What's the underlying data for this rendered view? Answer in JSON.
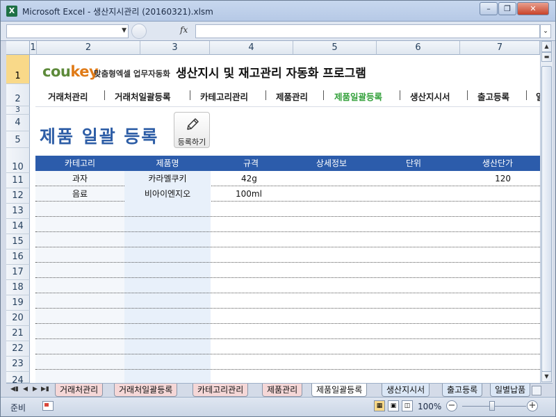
{
  "window": {
    "title": "Microsoft Excel - 생산지시관리 (20160321).xlsm",
    "app_icon": "excel-icon",
    "controls": [
      "minimize",
      "restore",
      "close"
    ]
  },
  "formula_bar": {
    "name_box": "",
    "fx_label": "fx",
    "formula": ""
  },
  "columns": [
    "1",
    "2",
    "3",
    "4",
    "5",
    "6",
    "7"
  ],
  "rows": [
    "1",
    "2",
    "3",
    "4",
    "5",
    "10",
    "11",
    "12",
    "13",
    "14",
    "15",
    "16",
    "17",
    "18",
    "19",
    "20",
    "21",
    "22",
    "23",
    "24"
  ],
  "banner": {
    "brand_a": "cou",
    "brand_b": "key",
    "brand_sub": "맞춤형엑셀 업무자동화",
    "title": "생산지시 및 재고관리 자동화 프로그램"
  },
  "nav": {
    "items": [
      "거래처관리",
      "거래처일괄등록",
      "카테고리관리",
      "제품관리",
      "제품일괄등록",
      "생산지시서",
      "출고등록",
      "일"
    ],
    "active_index": 4
  },
  "page": {
    "title": "제품 일괄 등록",
    "register_button": "등록하기"
  },
  "table": {
    "headers": [
      "카테고리",
      "제품명",
      "규격",
      "상세정보",
      "단위",
      "생산단가"
    ],
    "rows": [
      [
        "과자",
        "카라멜쿠키",
        "42g",
        "",
        "",
        "120"
      ],
      [
        "음료",
        "비아이엔지오",
        "100ml",
        "",
        "",
        ""
      ]
    ]
  },
  "sheet_tabs": {
    "items": [
      "거래처관리",
      "거래처일괄등록",
      "카테고리관리",
      "제품관리",
      "제품일괄등록",
      "생산지시서",
      "출고등록",
      "일별납품"
    ],
    "active_index": 4
  },
  "status": {
    "ready": "준비",
    "zoom": "100%"
  },
  "colors": {
    "accent_blue": "#2c5cab",
    "nav_active": "#32a03a",
    "brand_green": "#5d8a3a",
    "brand_orange": "#e07b18"
  }
}
